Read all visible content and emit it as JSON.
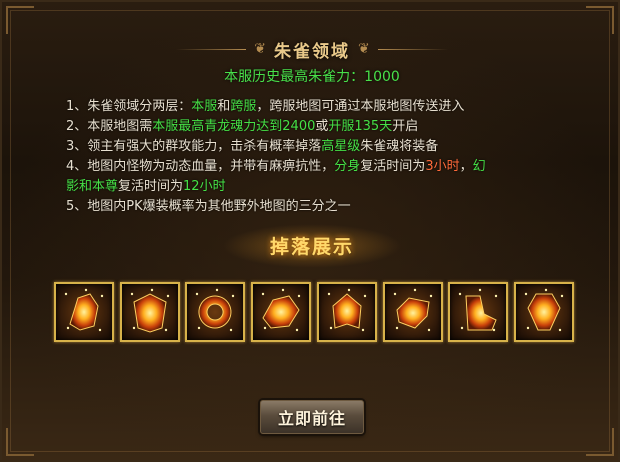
{
  "panel": {
    "title": "朱雀领域",
    "record_label": "本服历史最高朱雀力：1000"
  },
  "rules": [
    [
      {
        "text": "1、朱雀领域分两层：",
        "color": "white"
      },
      {
        "text": "本服",
        "color": "green"
      },
      {
        "text": "和",
        "color": "white"
      },
      {
        "text": "跨服",
        "color": "green"
      },
      {
        "text": "，跨服地图可通过本服地图传送进入",
        "color": "white"
      }
    ],
    [
      {
        "text": "2、本服地图需",
        "color": "white"
      },
      {
        "text": "本服最高青龙魂力达到2400",
        "color": "green"
      },
      {
        "text": "或",
        "color": "white"
      },
      {
        "text": "开服135天",
        "color": "green"
      },
      {
        "text": "开启",
        "color": "white"
      }
    ],
    [
      {
        "text": "3、领主有强大的群攻能力，击杀有概率掉落",
        "color": "white"
      },
      {
        "text": "高星级",
        "color": "green"
      },
      {
        "text": "朱雀魂将装备",
        "color": "white"
      }
    ],
    [
      {
        "text": "4、地图内怪物为动态血量，并带有麻痹抗性，",
        "color": "white"
      },
      {
        "text": "分身",
        "color": "green"
      },
      {
        "text": "复活时间为",
        "color": "white"
      },
      {
        "text": "3小时",
        "color": "red"
      },
      {
        "text": "，",
        "color": "white"
      },
      {
        "text": "幻",
        "color": "green"
      }
    ],
    [
      {
        "text": "影和本尊",
        "color": "green"
      },
      {
        "text": "复活时间为",
        "color": "white"
      },
      {
        "text": "12小时",
        "color": "green"
      }
    ],
    [
      {
        "text": "5、地图内PK爆装概率为其他野外地图的三分之一",
        "color": "white"
      }
    ]
  ],
  "drops": {
    "title": "掉落展示",
    "items": [
      {
        "icon": "bracer-icon"
      },
      {
        "icon": "armor-icon"
      },
      {
        "icon": "ring-icon"
      },
      {
        "icon": "bracelet-icon"
      },
      {
        "icon": "helmet-icon"
      },
      {
        "icon": "belt-icon"
      },
      {
        "icon": "boots-icon"
      },
      {
        "icon": "necklace-icon"
      }
    ]
  },
  "actions": {
    "go_label": "立即前往"
  },
  "colors": {
    "green": "#46e046",
    "red": "#ff6a3a",
    "white": "#e8e0d0",
    "gold": "#e9c98a"
  }
}
